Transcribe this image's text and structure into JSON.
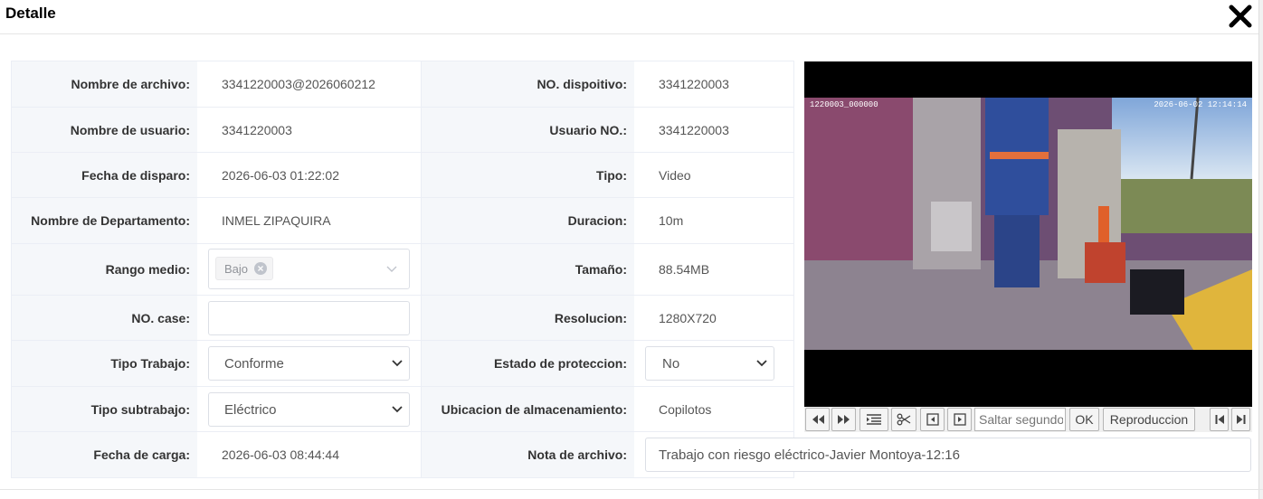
{
  "header": {
    "title": "Detalle"
  },
  "fields": {
    "nombre_archivo": {
      "label": "Nombre de archivo",
      "value": "3341220003@2026060212"
    },
    "no_dispositivo": {
      "label": "NO. dispoitivo",
      "value": "3341220003"
    },
    "nombre_usuario": {
      "label": "Nombre de usuario",
      "value": "3341220003"
    },
    "usuario_no": {
      "label": "Usuario NO.",
      "value": "3341220003"
    },
    "fecha_disparo": {
      "label": "Fecha de disparo",
      "value": "2026-06-03 01:22:02"
    },
    "tipo": {
      "label": "Tipo",
      "value": "Video"
    },
    "departamento": {
      "label": "Nombre de Departamento",
      "value": "INMEL ZIPAQUIRA"
    },
    "duracion": {
      "label": "Duracion",
      "value": "10m"
    },
    "rango_medio": {
      "label": "Rango medio",
      "tag": "Bajo"
    },
    "tamano": {
      "label": "Tamaño",
      "value": "88.54MB"
    },
    "no_case": {
      "label": "NO. case",
      "value": ""
    },
    "resolucion": {
      "label": "Resolucion",
      "value": "1280X720"
    },
    "tipo_trabajo": {
      "label": "Tipo Trabajo",
      "value": "Conforme"
    },
    "estado_proteccion": {
      "label": "Estado de proteccion",
      "value": "No"
    },
    "tipo_subtrabajo": {
      "label": "Tipo subtrabajo",
      "value": "Eléctrico"
    },
    "ubicacion": {
      "label": "Ubicacion de almacenamiento",
      "value": "Copilotos"
    },
    "fecha_carga": {
      "label": "Fecha de carga",
      "value": "2026-06-03 08:44:44"
    },
    "nota_archivo": {
      "label": "Nota de archivo",
      "value": "Trabajo con riesgo eléctrico-Javier Montoya-12:16"
    }
  },
  "label_suffix": ":",
  "video": {
    "overlay_left": "1220003_000000",
    "overlay_right": "2026-06-02 12:14:14"
  },
  "player": {
    "seek_placeholder": "Saltar segundo",
    "ok_label": "OK",
    "playback_label": "Reproduccion"
  },
  "colors": {
    "accent": "#dcdfe6",
    "label_bg": "#f5f7fa"
  }
}
